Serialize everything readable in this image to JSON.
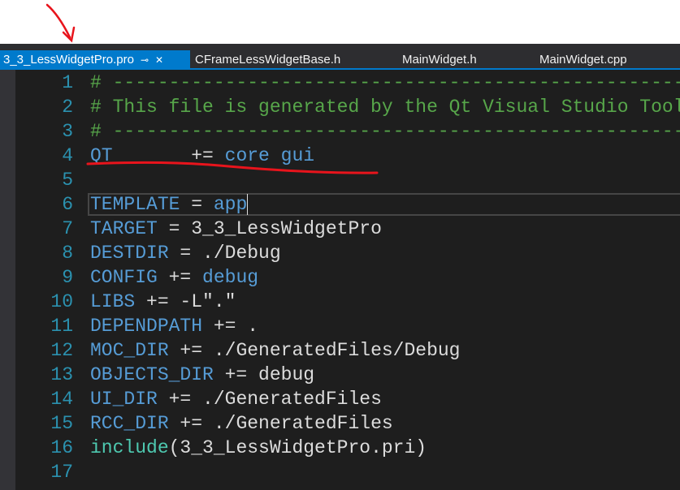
{
  "tabs": [
    {
      "label": "3_3_LessWidgetPro.pro",
      "active": true,
      "pin_icon": "pin-icon",
      "close_icon": "close-icon"
    },
    {
      "label": "CFrameLessWidgetBase.h",
      "active": false
    },
    {
      "label": "MainWidget.h",
      "active": false
    },
    {
      "label": "MainWidget.cpp",
      "active": false
    }
  ],
  "tab_symbols": {
    "pin": "⊸",
    "close": "✕"
  },
  "colors": {
    "accent": "#007acc",
    "background": "#1e1e1e",
    "comment": "#57a64a",
    "keyword": "#569cd6",
    "line_number": "#2b91af",
    "annotation": "#e8141c"
  },
  "editor": {
    "current_line": 6,
    "lines": [
      {
        "n": "1",
        "tokens": [
          {
            "t": "# -----------------------------------------------------",
            "c": "comment"
          }
        ]
      },
      {
        "n": "2",
        "tokens": [
          {
            "t": "# This file is generated by the Qt Visual Studio Tools",
            "c": "comment"
          }
        ]
      },
      {
        "n": "3",
        "tokens": [
          {
            "t": "# -----------------------------------------------------",
            "c": "comment"
          }
        ]
      },
      {
        "n": "4",
        "tokens": [
          {
            "t": "QT",
            "c": "kw"
          },
          {
            "t": "       += ",
            "c": "text"
          },
          {
            "t": "core gui",
            "c": "kw"
          }
        ]
      },
      {
        "n": "5",
        "tokens": []
      },
      {
        "n": "6",
        "tokens": [
          {
            "t": "TEMPLATE",
            "c": "kw"
          },
          {
            "t": " = ",
            "c": "text"
          },
          {
            "t": "app",
            "c": "kw"
          }
        ]
      },
      {
        "n": "7",
        "tokens": [
          {
            "t": "TARGET",
            "c": "kw"
          },
          {
            "t": " = 3_3_LessWidgetPro",
            "c": "text"
          }
        ]
      },
      {
        "n": "8",
        "tokens": [
          {
            "t": "DESTDIR",
            "c": "kw"
          },
          {
            "t": " = ./Debug",
            "c": "text"
          }
        ]
      },
      {
        "n": "9",
        "tokens": [
          {
            "t": "CONFIG",
            "c": "kw"
          },
          {
            "t": " += ",
            "c": "text"
          },
          {
            "t": "debug",
            "c": "kw"
          }
        ]
      },
      {
        "n": "10",
        "tokens": [
          {
            "t": "LIBS",
            "c": "kw"
          },
          {
            "t": " += -L\".\"",
            "c": "text"
          }
        ]
      },
      {
        "n": "11",
        "tokens": [
          {
            "t": "DEPENDPATH",
            "c": "kw"
          },
          {
            "t": " += .",
            "c": "text"
          }
        ]
      },
      {
        "n": "12",
        "tokens": [
          {
            "t": "MOC_DIR",
            "c": "kw"
          },
          {
            "t": " += ./GeneratedFiles/Debug",
            "c": "text"
          }
        ]
      },
      {
        "n": "13",
        "tokens": [
          {
            "t": "OBJECTS_DIR",
            "c": "kw"
          },
          {
            "t": " += debug",
            "c": "text"
          }
        ]
      },
      {
        "n": "14",
        "tokens": [
          {
            "t": "UI_DIR",
            "c": "kw"
          },
          {
            "t": " += ./GeneratedFiles",
            "c": "text"
          }
        ]
      },
      {
        "n": "15",
        "tokens": [
          {
            "t": "RCC_DIR",
            "c": "kw"
          },
          {
            "t": " += ./GeneratedFiles",
            "c": "text"
          }
        ]
      },
      {
        "n": "16",
        "tokens": [
          {
            "t": "include",
            "c": "func"
          },
          {
            "t": "(3_3_LessWidgetPro.pri)",
            "c": "text"
          }
        ]
      },
      {
        "n": "17",
        "tokens": []
      }
    ]
  }
}
